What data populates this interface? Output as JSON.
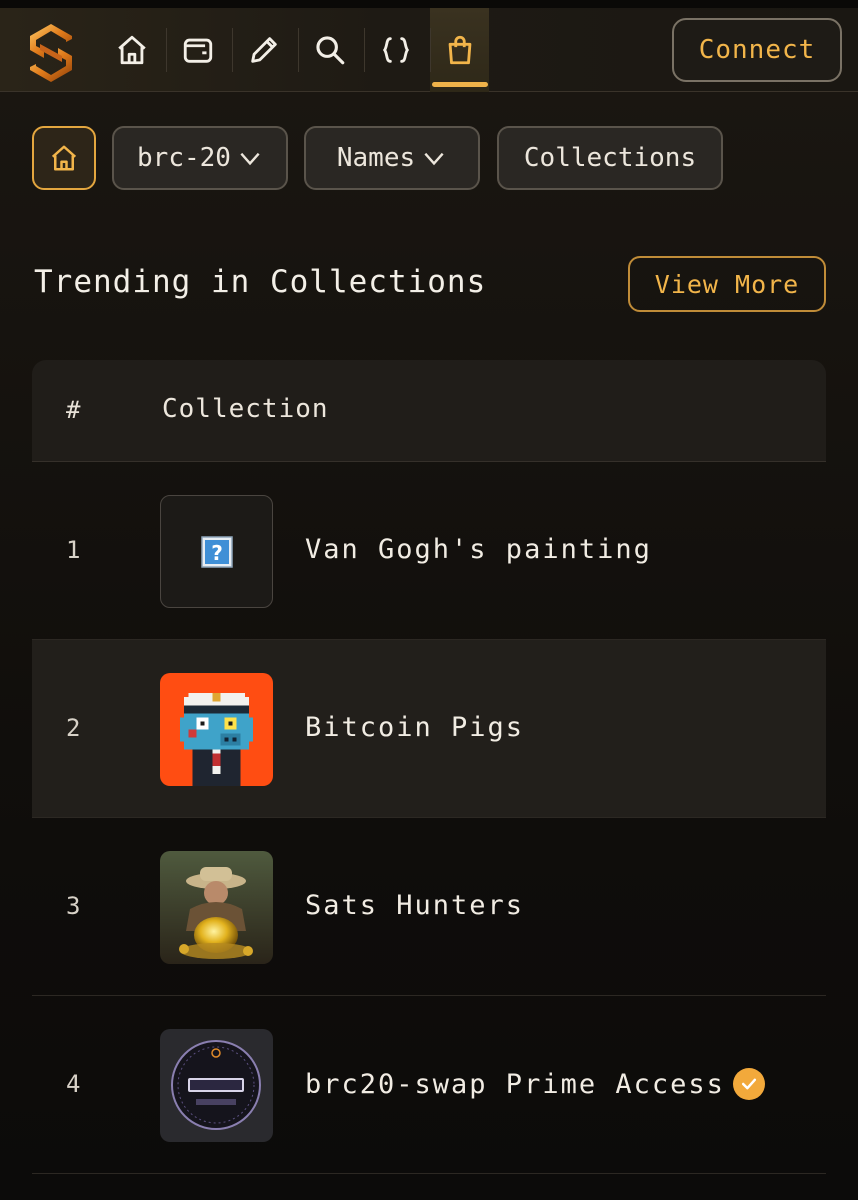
{
  "header": {
    "nav": [
      {
        "icon": "home-icon"
      },
      {
        "icon": "wallet-icon"
      },
      {
        "icon": "pencil-icon"
      },
      {
        "icon": "search-icon"
      },
      {
        "icon": "braces-icon"
      },
      {
        "icon": "shopping-bag-icon",
        "active": true
      }
    ],
    "connect_label": "Connect"
  },
  "filters": {
    "home_icon": "home-icon",
    "brc20_label": "brc-20",
    "names_label": "Names",
    "collections_label": "Collections"
  },
  "section": {
    "title": "Trending in Collections",
    "view_more_label": "View More"
  },
  "table": {
    "headers": {
      "rank": "#",
      "collection": "Collection"
    },
    "rows": [
      {
        "rank": "1",
        "name": "Van Gogh's painting",
        "thumb": "broken-image-icon"
      },
      {
        "rank": "2",
        "name": "Bitcoin Pigs",
        "thumb": "pixel-pig-captain"
      },
      {
        "rank": "3",
        "name": "Sats Hunters",
        "thumb": "treasure-hunter"
      },
      {
        "rank": "4",
        "name": "brc20-swap Prime Access",
        "thumb": "brc20-swap-badge",
        "verified": true
      }
    ]
  },
  "colors": {
    "accent": "#f2b54a",
    "background": "#15120e",
    "pig_bg": "#ff4d12"
  }
}
